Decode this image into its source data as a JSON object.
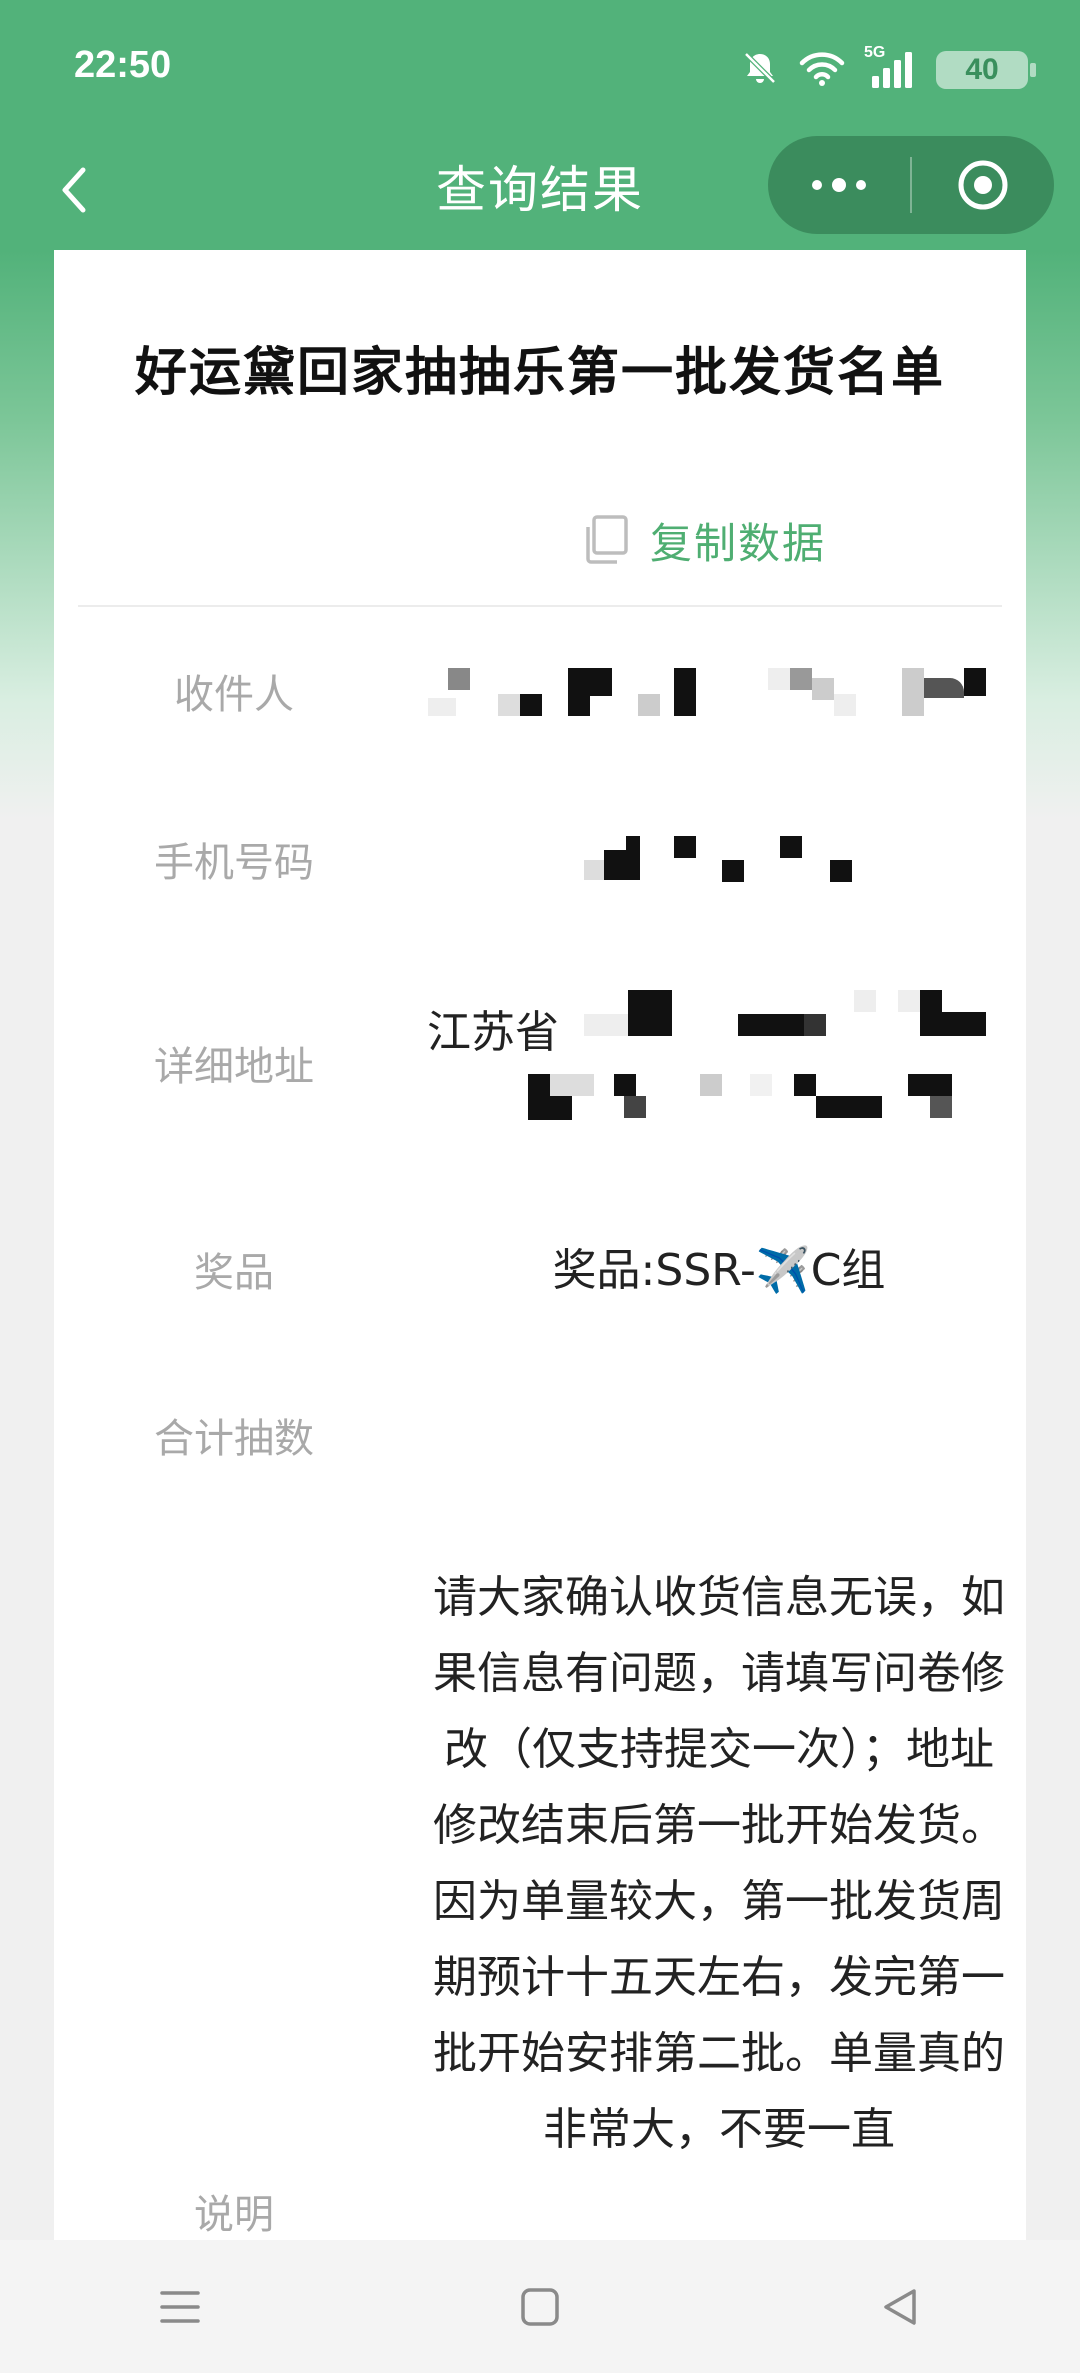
{
  "status_bar": {
    "time": "22:50",
    "network": "5G",
    "battery": "40",
    "icons": [
      "mute-bell-icon",
      "wifi-icon",
      "signal-5g-icon",
      "battery-icon"
    ]
  },
  "nav": {
    "title": "查询结果",
    "back_icon": "chevron-left-icon",
    "more_icon": "more-dots-icon",
    "close_icon": "target-close-icon"
  },
  "card": {
    "title": "好运黛回家抽抽乐第一批发货名单",
    "copy_label": "复制数据",
    "copy_icon": "copy-icon"
  },
  "fields": {
    "recipient_label": "收件人",
    "phone_label": "手机号码",
    "address_label": "详细地址",
    "address_prefix": "江苏省",
    "prize_label": "奖品",
    "prize_value": "奖品:SSR-✈️C组",
    "total_draws_label": "合计抽数",
    "total_draws_value": "",
    "note_label": "说明"
  },
  "note_text": "请大家确认收货信息无误，如果信息有问题，请填写问卷修改（仅支持提交一次）；地址修改结束后第一批开始发货。因为单量较大，第一批发货周期预计十五天左右，发完第一批开始安排第二批。单量真的非常大，不要一直",
  "system_nav": {
    "menu_icon": "menu-icon",
    "home_icon": "home-square-icon",
    "back_icon": "back-triangle-icon"
  },
  "colors": {
    "brand_green": "#52b27a",
    "copy_green": "#4fae72",
    "label_gray": "#a9a9a9"
  }
}
